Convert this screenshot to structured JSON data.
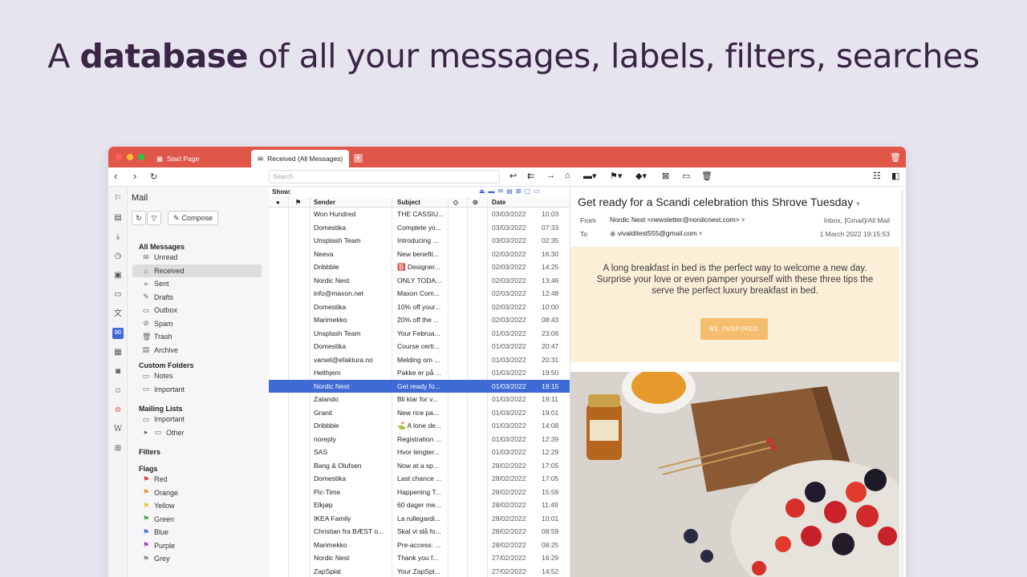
{
  "headline": {
    "prefix": "A",
    "bold": "database",
    "rest": "of all your messages, labels, filters, searches"
  },
  "colors": {
    "brand": "#e0574a",
    "accent": "#3f69d9",
    "banner": "#fcefd8",
    "inspire": "#f6bd6e"
  },
  "tabs": {
    "start": "Start Page",
    "active": "Received (All Messages)"
  },
  "toolbar": {
    "search_placeholder": "Search"
  },
  "panel": {
    "title": "Mail",
    "compose": "Compose",
    "all_messages": "All Messages",
    "mail_items": [
      "Unread",
      "Received",
      "Sent",
      "Drafts",
      "Outbox",
      "Spam",
      "Trash",
      "Archive"
    ],
    "custom_folders": "Custom Folders",
    "custom_items": [
      "Notes",
      "Important"
    ],
    "mailing_lists": "Mailing Lists",
    "mailing_items": [
      "Important",
      "Other"
    ],
    "filters": "Filters",
    "flags_title": "Flags",
    "flags": [
      {
        "name": "Red",
        "color": "#e53935"
      },
      {
        "name": "Orange",
        "color": "#f28c28"
      },
      {
        "name": "Yellow",
        "color": "#e5c52b"
      },
      {
        "name": "Green",
        "color": "#43a047"
      },
      {
        "name": "Blue",
        "color": "#3b6fe0"
      },
      {
        "name": "Purple",
        "color": "#8e44ad"
      },
      {
        "name": "Grey",
        "color": "#8a8a8a"
      }
    ]
  },
  "list": {
    "show": "Show:",
    "headers": {
      "sender": "Sender",
      "subject": "Subject",
      "date": "Date"
    },
    "rows": [
      {
        "sender": "Won Hundred",
        "subject": "THE CASSIU...",
        "date": "03/03/2022",
        "time": "10:03"
      },
      {
        "sender": "Domestika",
        "subject": "Complete yo...",
        "date": "03/03/2022",
        "time": "07:33"
      },
      {
        "sender": "Unsplash Team",
        "subject": "Introducing ...",
        "date": "03/03/2022",
        "time": "02:35"
      },
      {
        "sender": "Neeva",
        "subject": "New benefit...",
        "date": "02/03/2022",
        "time": "16:30"
      },
      {
        "sender": "Dribbble",
        "subject": "🅱️ Designer...",
        "date": "02/03/2022",
        "time": "14:25"
      },
      {
        "sender": "Nordic Nest",
        "subject": "ONLY TODA...",
        "date": "02/03/2022",
        "time": "13:46"
      },
      {
        "sender": "info@maxon.net",
        "subject": "Maxon Com...",
        "date": "02/03/2022",
        "time": "12:48"
      },
      {
        "sender": "Domestika",
        "subject": "10% off your...",
        "date": "02/03/2022",
        "time": "10:00"
      },
      {
        "sender": "Marimekko",
        "subject": "20% off the ...",
        "date": "02/03/2022",
        "time": "08:43"
      },
      {
        "sender": "Unsplash Team",
        "subject": "Your Februa...",
        "date": "01/03/2022",
        "time": "23:06"
      },
      {
        "sender": "Domestika",
        "subject": "Course certi...",
        "date": "01/03/2022",
        "time": "20:47"
      },
      {
        "sender": "varsel@efaktura.no",
        "subject": "Melding om ...",
        "date": "01/03/2022",
        "time": "20:31"
      },
      {
        "sender": "Helthjem",
        "subject": "Pakke er på ...",
        "date": "01/03/2022",
        "time": "19:50"
      },
      {
        "sender": "Nordic Nest",
        "subject": "Get ready fo...",
        "date": "01/03/2022",
        "time": "19:15",
        "selected": true
      },
      {
        "sender": "Zalando",
        "subject": "Bli klar for v...",
        "date": "01/03/2022",
        "time": "19:11"
      },
      {
        "sender": "Granit",
        "subject": "New rice pa...",
        "date": "01/03/2022",
        "time": "19:01"
      },
      {
        "sender": "Dribbble",
        "subject": "⛳ A lone de...",
        "date": "01/03/2022",
        "time": "14:08"
      },
      {
        "sender": "noreply",
        "subject": "Registration ...",
        "date": "01/03/2022",
        "time": "12:39"
      },
      {
        "sender": "SAS",
        "subject": "Hvor lengter...",
        "date": "01/03/2022",
        "time": "12:29"
      },
      {
        "sender": "Bang & Olufsen",
        "subject": "Now at a sp...",
        "date": "28/02/2022",
        "time": "17:05"
      },
      {
        "sender": "Domestika",
        "subject": "Last chance ...",
        "date": "28/02/2022",
        "time": "17:05"
      },
      {
        "sender": "Pic-Time",
        "subject": "Happening T...",
        "date": "28/02/2022",
        "time": "15:59"
      },
      {
        "sender": "Elkjøp",
        "subject": "60 dager me...",
        "date": "28/02/2022",
        "time": "11:49"
      },
      {
        "sender": "IKEA Family",
        "subject": "La rullegardi...",
        "date": "28/02/2022",
        "time": "10:01"
      },
      {
        "sender": "Christian fra BÆST o...",
        "subject": "Skal vi slå fo...",
        "date": "28/02/2022",
        "time": "08:59"
      },
      {
        "sender": "Marimekko",
        "subject": "Pre-access: ...",
        "date": "28/02/2022",
        "time": "08:25"
      },
      {
        "sender": "Nordic Nest",
        "subject": "Thank you f...",
        "date": "27/02/2022",
        "time": "16:29"
      },
      {
        "sender": "ZapSplat",
        "subject": "Your ZapSpl...",
        "date": "27/02/2022",
        "time": "14:52"
      }
    ]
  },
  "reader": {
    "subject": "Get ready for a Scandi celebration this Shrove Tuesday",
    "from_label": "From",
    "from": "Nordic Nest <newsletter@nordicnest.com>",
    "to_label": "To",
    "to": "vivalditest555@gmail.com",
    "folders": "Inbox, [Gmail]/All Mail",
    "date": "1 March 2022 19:15:53",
    "banner_text": "A long breakfast in bed is the perfect way to welcome a new day. Surprise your love or even pamper yourself with these three tips the serve the perfect luxury breakfast in bed.",
    "cta": "BE INSPIRED"
  }
}
